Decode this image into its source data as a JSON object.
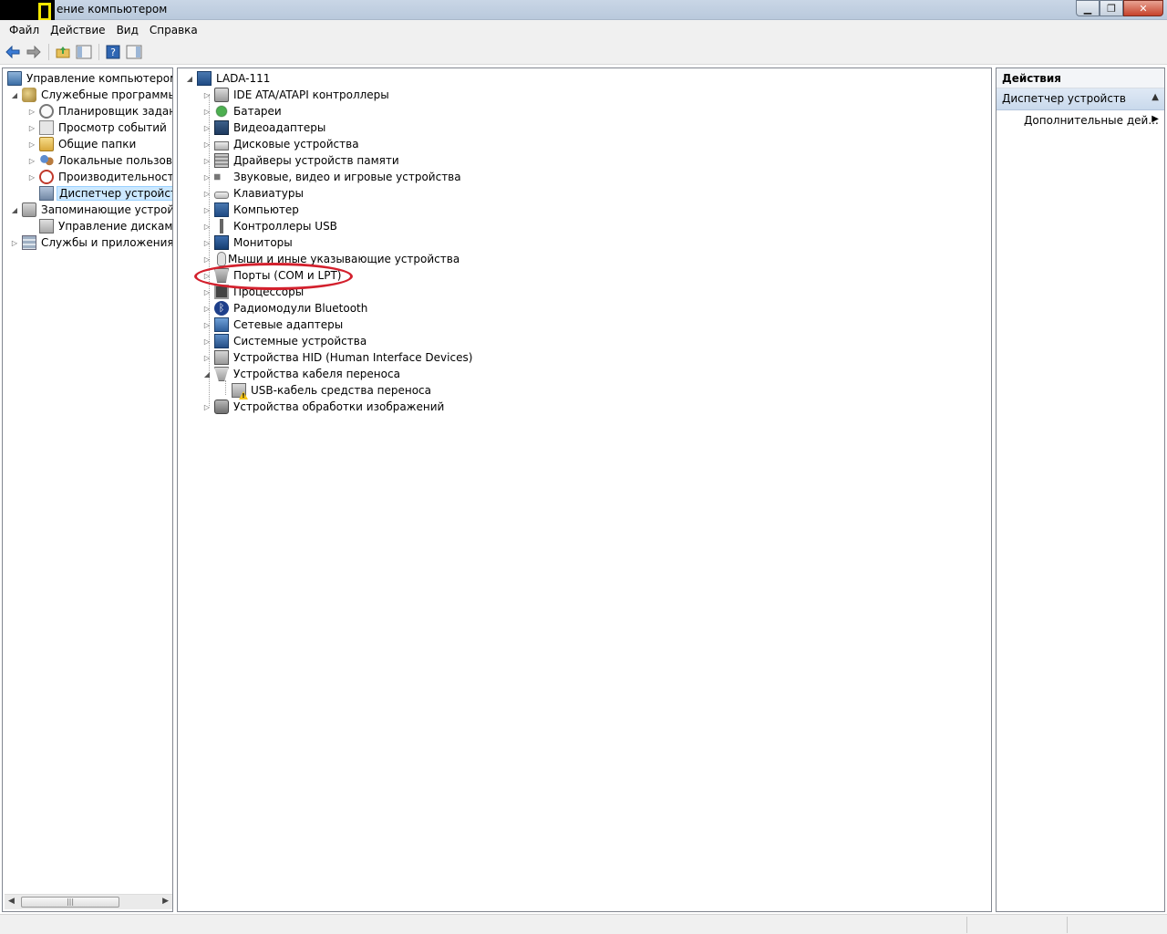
{
  "window": {
    "title": "ение компьютером",
    "buttons": {
      "minimize": "▁",
      "restore": "❐",
      "close": "✕"
    }
  },
  "menubar": {
    "items": [
      "Файл",
      "Действие",
      "Вид",
      "Справка"
    ]
  },
  "toolbar": {
    "buttons": [
      "back-icon",
      "forward-icon",
      "up-folder-icon",
      "show-hide-tree-icon",
      "help-icon",
      "show-hide-action-pane-icon"
    ]
  },
  "left_tree": {
    "root": "Управление компьютером (л",
    "system_tools": "Служебные программы",
    "task_scheduler": "Планировщик заданий",
    "event_viewer": "Просмотр событий",
    "shared_folders": "Общие папки",
    "local_users": "Локальные пользовате",
    "performance": "Производительность",
    "device_manager": "Диспетчер устройств",
    "storage": "Запоминающие устройст",
    "disk_management": "Управление дисками",
    "services_apps": "Службы и приложения"
  },
  "device_tree": {
    "computer_name": "LADA-111",
    "categories": [
      "IDE ATA/ATAPI контроллеры",
      "Батареи",
      "Видеоадаптеры",
      "Дисковые устройства",
      "Драйверы устройств памяти",
      "Звуковые, видео и игровые устройства",
      "Клавиатуры",
      "Компьютер",
      "Контроллеры USB",
      "Мониторы",
      "Мыши и иные указывающие устройства",
      "Порты (COM и LPT)",
      "Процессоры",
      "Радиомодули Bluetooth",
      "Сетевые адаптеры",
      "Системные устройства",
      "Устройства HID (Human Interface Devices)",
      "Устройства кабеля переноса",
      "Устройства обработки изображений"
    ],
    "child_of_transfer_cable": "USB-кабель средства переноса",
    "highlighted": "Порты (COM и LPT)",
    "highlight_color": "#d3202d"
  },
  "actions_pane": {
    "header": "Действия",
    "section": "Диспетчер устройств",
    "item": "Дополнительные дей..."
  },
  "colors": {
    "selection": "#cce8ff",
    "titlebar": "#c9d6e6"
  }
}
